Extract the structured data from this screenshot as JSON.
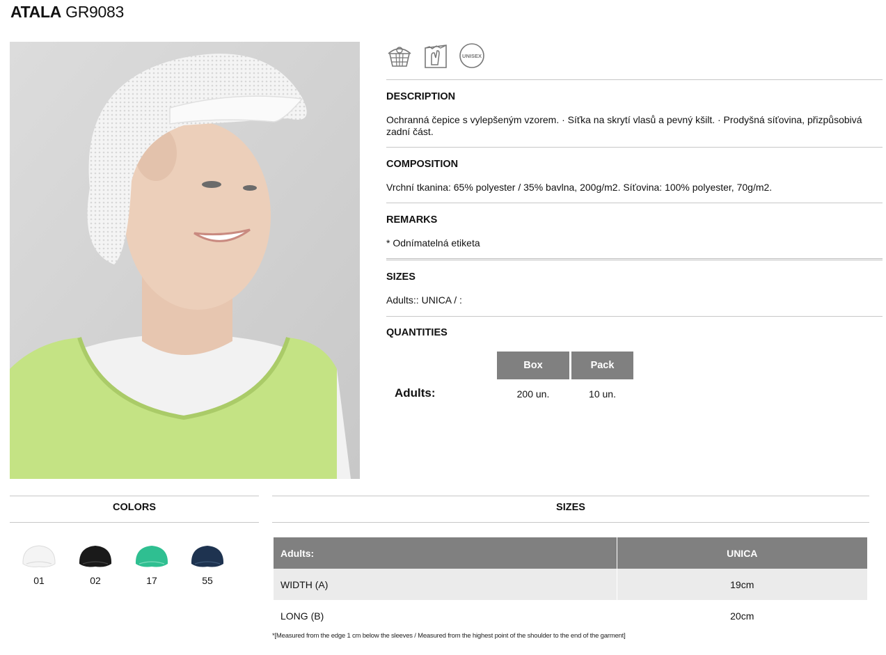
{
  "product": {
    "name": "ATALA",
    "code": "GR9083"
  },
  "badges": [
    {
      "icon": "food-basket-icon"
    },
    {
      "icon": "tearable-tag-icon"
    },
    {
      "icon": "unisex-icon",
      "label": "UNISEX"
    }
  ],
  "description": {
    "title": "DESCRIPTION",
    "text": "Ochranná čepice s vylepšeným vzorem. · Síťka na skrytí vlasů a pevný kšilt. · Prodyšná síťovina, přizpůsobivá zadní část."
  },
  "composition": {
    "title": "COMPOSITION",
    "text": "Vrchní tkanina: 65% polyester / 35% bavlna, 200g/m2. Síťovina: 100% polyester, 70g/m2."
  },
  "remarks": {
    "title": "REMARKS",
    "text": "* Odnímatelná etiketa"
  },
  "sizes_info": {
    "title": "SIZES",
    "text": "Adults:: UNICA / :"
  },
  "quantities": {
    "title": "QUANTITIES",
    "headers": [
      "Box",
      "Pack"
    ],
    "row_label": "Adults:",
    "values": [
      "200 un.",
      "10 un."
    ]
  },
  "colors": {
    "title": "COLORS",
    "items": [
      {
        "code": "01",
        "color": "#f4f4f4"
      },
      {
        "code": "02",
        "color": "#1a1a1a"
      },
      {
        "code": "17",
        "color": "#2fbf91"
      },
      {
        "code": "55",
        "color": "#1e3350"
      }
    ]
  },
  "size_table": {
    "title": "SIZES",
    "header": [
      "Adults:",
      "UNICA"
    ],
    "rows": [
      [
        "WIDTH (A)",
        "19cm"
      ],
      [
        "LONG (B)",
        "20cm"
      ]
    ],
    "note": "*[Measured from the edge 1 cm below the sleeves / Measured from the highest point of the shoulder to the end of the garment]"
  },
  "theme": {
    "header_gray": "#808080",
    "rule_gray": "#c7c7c7",
    "vest_green": "#c4e384"
  }
}
